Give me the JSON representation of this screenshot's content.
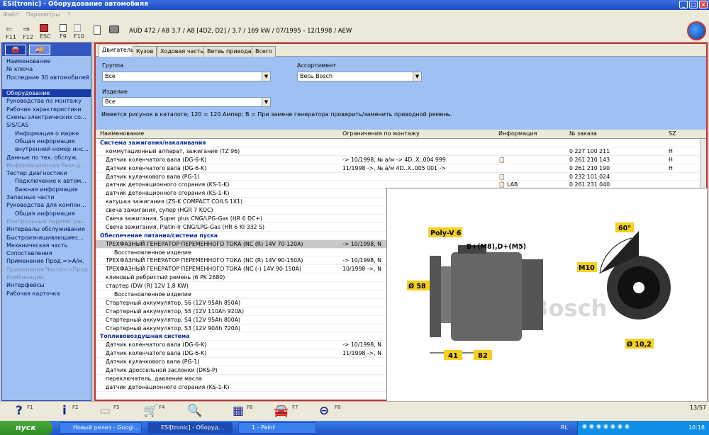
{
  "window": {
    "title": "ESI[tronic] - Оборудование автомобиля"
  },
  "menu": [
    "Файл",
    "Параметры",
    "?"
  ],
  "toolbar": {
    "buttons": [
      {
        "label": "F11",
        "icon": "back-arrow-icon"
      },
      {
        "label": "F12",
        "icon": "forward-arrow-icon"
      },
      {
        "label": "ESC",
        "icon": "exit-icon"
      },
      {
        "label": "F9",
        "icon": "document-icon"
      },
      {
        "label": "F10",
        "icon": "document-gray-icon"
      }
    ],
    "vehicle": "AUD 472 / A8 3.7 / A8 [4D2, D2] / 3.7 / 169 kW / 07/1995 - 12/1998 / AEW"
  },
  "sidebar": {
    "items": [
      {
        "label": "Наименование",
        "state": "normal"
      },
      {
        "label": "№ ключа",
        "state": "normal"
      },
      {
        "label": "Последние 30 автомобилей",
        "state": "normal"
      },
      {
        "label": "",
        "state": "gap"
      },
      {
        "label": "Оборудование",
        "state": "selected"
      },
      {
        "label": "Руководства по монтажу",
        "state": "normal"
      },
      {
        "label": "Рабочие характеристики",
        "state": "normal"
      },
      {
        "label": "Схемы электрических со...",
        "state": "normal"
      },
      {
        "label": "SIS/CAS",
        "state": "normal"
      },
      {
        "label": "Информация о марке",
        "state": "indent"
      },
      {
        "label": "Общая информация",
        "state": "indent"
      },
      {
        "label": "внутренний номер инс...",
        "state": "indent"
      },
      {
        "label": "Данные по тех. обслуж.",
        "state": "normal"
      },
      {
        "label": "Информационная база д...",
        "state": "disabled"
      },
      {
        "label": "Тестер диагностики",
        "state": "normal"
      },
      {
        "label": "Подключение к автом...",
        "state": "indent"
      },
      {
        "label": "Важная информация",
        "state": "indent"
      },
      {
        "label": "Запасные части",
        "state": "normal"
      },
      {
        "label": "Руководства для компон...",
        "state": "normal"
      },
      {
        "label": "Общая информация",
        "state": "indent"
      },
      {
        "label": "Контрольные параметры...",
        "state": "disabled"
      },
      {
        "label": "Интервалы обслуживания",
        "state": "normal"
      },
      {
        "label": "Быстроизнашивающиес...",
        "state": "normal"
      },
      {
        "label": "Механическая часть",
        "state": "normal"
      },
      {
        "label": "Сопоставления",
        "state": "normal"
      },
      {
        "label": "Применение Прод.=>А/м.",
        "state": "normal"
      },
      {
        "label": "Применение Части=>Прод.",
        "state": "disabled"
      },
      {
        "label": "Комбинации",
        "state": "disabled"
      },
      {
        "label": "Интерфейсы",
        "state": "normal"
      },
      {
        "label": "Рабочая карточка",
        "state": "normal"
      }
    ]
  },
  "tabs": [
    {
      "label": "Двигатель",
      "active": true
    },
    {
      "label": "Кузов",
      "active": false
    },
    {
      "label": "Ходовая часть",
      "active": false
    },
    {
      "label": "Ветвь привода",
      "active": false
    },
    {
      "label": "Всего",
      "active": false
    }
  ],
  "filters": {
    "group_label": "Группа",
    "group_value": "Все",
    "assortment_label": "Ассортимент",
    "assortment_value": "Весь Bosch",
    "product_label": "Изделие",
    "product_value": "Все",
    "note": "Имеется рисунок в каталоге; 120 = 120 Ампер; B = При замене генератора проверить/заменить приводной ремень."
  },
  "table": {
    "headers": [
      "Наименование",
      "Ограничения по монтажу",
      "Информация",
      "№ заказа",
      "SZ"
    ],
    "rows": [
      {
        "type": "section",
        "name": "Система зажигания/накаливания",
        "limits": "",
        "info": "",
        "order": "",
        "sz": ""
      },
      {
        "type": "item",
        "name": "коммутационный аппарат, зажигание (TZ 96)",
        "limits": "",
        "info": "",
        "order": "0 227 100 211",
        "sz": "H"
      },
      {
        "type": "item",
        "name": "Датчик коленчатого вала (DG-6-K)",
        "limits": "-> 10/1998,   № а/м -> 4D..X..004 999",
        "info": "📋",
        "order": "0 261 210 143",
        "sz": "H"
      },
      {
        "type": "item",
        "name": "Датчик коленчатого вала (DG-6-K)",
        "limits": "11/1998 ->,   № а/м 4D..X..005 001 ->",
        "info": "",
        "order": "0 261 210 190",
        "sz": "H"
      },
      {
        "type": "item",
        "name": "Датчик кулачкового вала (PG-1)",
        "limits": "",
        "info": "📋",
        "order": "0 232 101 024",
        "sz": ""
      },
      {
        "type": "item",
        "name": "датчик детонационного сгорания (KS-1-K)",
        "limits": "",
        "info": "📋 LAB",
        "order": "0 261 231 040",
        "sz": ""
      },
      {
        "type": "item",
        "name": "датчик детонационного сгорания (KS-1-K)",
        "limits": "",
        "info": "",
        "order": "",
        "sz": ""
      },
      {
        "type": "item",
        "name": "катушка зажигания (ZS-K COMPACT COILS 1X1)",
        "limits": "",
        "info": "",
        "order": "",
        "sz": ""
      },
      {
        "type": "item",
        "name": "свеча зажигания, супер (HGR 7 KQC)",
        "limits": "",
        "info": "",
        "order": "",
        "sz": ""
      },
      {
        "type": "item",
        "name": "Свеча зажигания, Super plus CNG/LPG-Gas (HR 6 DC+)",
        "limits": "",
        "info": "",
        "order": "",
        "sz": ""
      },
      {
        "type": "item",
        "name": "Свеча зажигания, Platin-Ir CNG/LPG-Gas (HR 6 KI 332 S)",
        "limits": "",
        "info": "",
        "order": "",
        "sz": ""
      },
      {
        "type": "section",
        "name": "Обеспечение питания/система пуска",
        "limits": "",
        "info": "",
        "order": "",
        "sz": ""
      },
      {
        "type": "highlight",
        "name": "ТРЕХФАЗНЫЙ ГЕНЕРАТОР ПЕРЕМЕННОГО ТОКА (NC (R) 14V 70-120A)",
        "limits": "-> 10/1998,   N",
        "info": "",
        "order": "",
        "sz": ""
      },
      {
        "type": "indent",
        "name": "Восстановленное изделие",
        "limits": "",
        "info": "",
        "order": "",
        "sz": ""
      },
      {
        "type": "item",
        "name": "ТРЕХФАЗНЫЙ ГЕНЕРАТОР ПЕРЕМЕННОГО ТОКА (NC (R) 14V 90-150A)",
        "limits": "-> 10/1998,   N",
        "info": "",
        "order": "",
        "sz": ""
      },
      {
        "type": "item",
        "name": "ТРЕХФАЗНЫЙ ГЕНЕРАТОР ПЕРЕМЕННОГО ТОКА (NC (-) 14V 90-150A)",
        "limits": "10/1998 ->,   N",
        "info": "",
        "order": "",
        "sz": ""
      },
      {
        "type": "item",
        "name": "клиновый ребристый ремень (6 PK 2680)",
        "limits": "",
        "info": "",
        "order": "",
        "sz": ""
      },
      {
        "type": "item",
        "name": "стартер (DW (R) 12V 1,8 KW)",
        "limits": "",
        "info": "",
        "order": "",
        "sz": ""
      },
      {
        "type": "indent",
        "name": "Восстановленное изделие",
        "limits": "",
        "info": "",
        "order": "",
        "sz": ""
      },
      {
        "type": "item",
        "name": "Стартерный аккумулятор, S6 (12V 95Ah 850A)",
        "limits": "",
        "info": "",
        "order": "",
        "sz": ""
      },
      {
        "type": "item",
        "name": "Стартерный аккумулятор, S5 (12V 110Ah 920A)",
        "limits": "",
        "info": "",
        "order": "",
        "sz": ""
      },
      {
        "type": "item",
        "name": "Стартерный аккумулятор, S4 (12V 95Ah 800A)",
        "limits": "",
        "info": "",
        "order": "",
        "sz": ""
      },
      {
        "type": "item",
        "name": "Стартерный аккумулятор, S3 (12V 90Ah 720A)",
        "limits": "",
        "info": "",
        "order": "",
        "sz": ""
      },
      {
        "type": "section",
        "name": "Топливовоздушная система",
        "limits": "",
        "info": "",
        "order": "",
        "sz": ""
      },
      {
        "type": "item",
        "name": "Датчик коленчатого вала (DG-6-K)",
        "limits": "-> 10/1998,   N",
        "info": "",
        "order": "",
        "sz": ""
      },
      {
        "type": "item",
        "name": "Датчик коленчатого вала (DG-6-K)",
        "limits": "11/1998 ->,   N",
        "info": "",
        "order": "",
        "sz": ""
      },
      {
        "type": "item",
        "name": "Датчик кулачкового вала (PG-1)",
        "limits": "",
        "info": "",
        "order": "",
        "sz": ""
      },
      {
        "type": "item",
        "name": "Датчик дроссельной заслонки (DKS-P)",
        "limits": "",
        "info": "",
        "order": "",
        "sz": ""
      },
      {
        "type": "item",
        "name": "переключатель, давление масла",
        "limits": "",
        "info": "",
        "order": "",
        "sz": ""
      },
      {
        "type": "item",
        "name": "датчик детонационного сгорания (KS-1-K)",
        "limits": "",
        "info": "",
        "order": "",
        "sz": ""
      }
    ]
  },
  "popup": {
    "belt_label": "Poly-V 6",
    "terminal_label": "B+(M8),D+(M5)",
    "diameter_label": "Ø 58",
    "dim1": "41",
    "dim2": "82",
    "angle_label": "60°",
    "bolt_label": "M10",
    "hole_label": "Ø 10,2",
    "watermark": "© Bosch"
  },
  "bottombar": {
    "keys": [
      "F1",
      "F2",
      "F5",
      "F4",
      "F6",
      "F7",
      "F8"
    ],
    "pager": "13/57"
  },
  "taskbar": {
    "start": "пуск",
    "tasks": [
      "Новый релиз - Googl...",
      "ESI[tronic] - Оборуд...",
      "1 - Paint"
    ],
    "lang": "RL",
    "time": "10:18"
  },
  "colors": {
    "accent": "#1a3ca8",
    "panel": "#9fc0f2",
    "highlight_border": "#c83030",
    "label_yellow": "#f5d020"
  }
}
